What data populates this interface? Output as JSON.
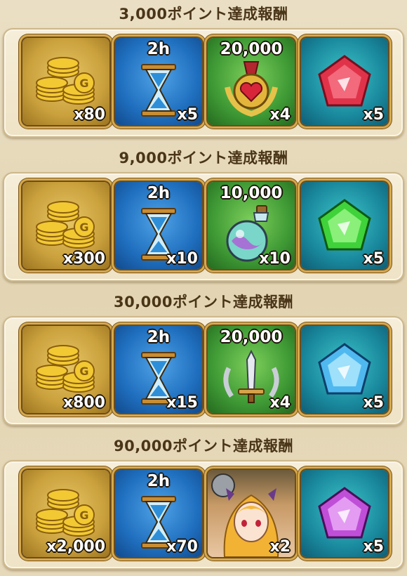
{
  "tiers": [
    {
      "title": "3,000ポイント達成報酬",
      "rewards": [
        {
          "icon": "gold-coins-icon",
          "qty": "x80"
        },
        {
          "icon": "hourglass-icon",
          "top": "2h",
          "qty": "x5"
        },
        {
          "icon": "heart-medal-icon",
          "top": "20,000",
          "qty": "x4"
        },
        {
          "icon": "red-gem-icon",
          "qty": "x5"
        }
      ]
    },
    {
      "title": "9,000ポイント達成報酬",
      "rewards": [
        {
          "icon": "gold-coins-icon",
          "qty": "x300"
        },
        {
          "icon": "hourglass-icon",
          "top": "2h",
          "qty": "x10"
        },
        {
          "icon": "potion-flask-icon",
          "top": "10,000",
          "qty": "x10"
        },
        {
          "icon": "green-gem-icon",
          "qty": "x5"
        }
      ]
    },
    {
      "title": "30,000ポイント達成報酬",
      "rewards": [
        {
          "icon": "gold-coins-icon",
          "qty": "x800"
        },
        {
          "icon": "hourglass-icon",
          "top": "2h",
          "qty": "x15"
        },
        {
          "icon": "sword-emblem-icon",
          "top": "20,000",
          "qty": "x4"
        },
        {
          "icon": "blue-gem-icon",
          "qty": "x5"
        }
      ]
    },
    {
      "title": "90,000ポイント達成報酬",
      "rewards": [
        {
          "icon": "gold-coins-icon",
          "qty": "x2,000"
        },
        {
          "icon": "hourglass-icon",
          "top": "2h",
          "qty": "x70"
        },
        {
          "icon": "character-portrait-icon",
          "qty": "x2"
        },
        {
          "icon": "purple-gem-icon",
          "qty": "x5"
        }
      ]
    }
  ],
  "colors": {
    "red_gem": "#e0334a",
    "green_gem": "#3fd23a",
    "blue_gem": "#4fb9ef",
    "purple_gem": "#c04fd8"
  }
}
